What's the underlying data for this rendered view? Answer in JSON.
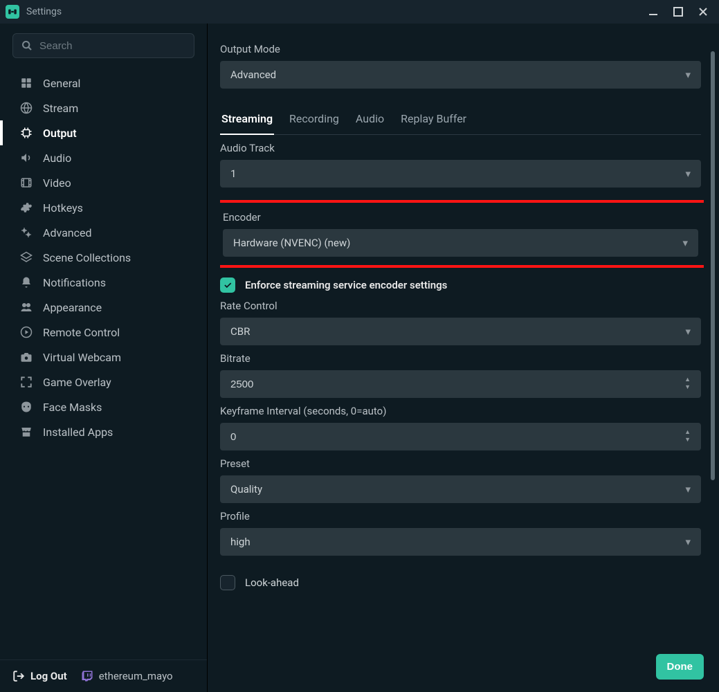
{
  "window": {
    "title": "Settings"
  },
  "search": {
    "placeholder": "Search"
  },
  "sidebar": {
    "items": [
      {
        "label": "General",
        "icon": "grid-icon"
      },
      {
        "label": "Stream",
        "icon": "globe-icon"
      },
      {
        "label": "Output",
        "icon": "chip-icon"
      },
      {
        "label": "Audio",
        "icon": "speaker-icon"
      },
      {
        "label": "Video",
        "icon": "film-icon"
      },
      {
        "label": "Hotkeys",
        "icon": "gear-icon"
      },
      {
        "label": "Advanced",
        "icon": "gears-icon"
      },
      {
        "label": "Scene Collections",
        "icon": "layers-icon"
      },
      {
        "label": "Notifications",
        "icon": "bell-icon"
      },
      {
        "label": "Appearance",
        "icon": "user-icon"
      },
      {
        "label": "Remote Control",
        "icon": "play-icon"
      },
      {
        "label": "Virtual Webcam",
        "icon": "camera-icon"
      },
      {
        "label": "Game Overlay",
        "icon": "expand-icon"
      },
      {
        "label": "Face Masks",
        "icon": "mask-icon"
      },
      {
        "label": "Installed Apps",
        "icon": "store-icon"
      }
    ],
    "activeIndex": 2
  },
  "footer": {
    "logout": "Log Out",
    "username": "ethereum_mayo"
  },
  "output": {
    "modeLabel": "Output Mode",
    "modeValue": "Advanced",
    "tabs": [
      "Streaming",
      "Recording",
      "Audio",
      "Replay Buffer"
    ],
    "activeTab": 0,
    "audioTrackLabel": "Audio Track",
    "audioTrackValue": "1",
    "encoderLabel": "Encoder",
    "encoderValue": "Hardware (NVENC) (new)",
    "enforceLabel": "Enforce streaming service encoder settings",
    "enforceChecked": true,
    "rateControlLabel": "Rate Control",
    "rateControlValue": "CBR",
    "bitrateLabel": "Bitrate",
    "bitrateValue": "2500",
    "keyframeLabel": "Keyframe Interval (seconds, 0=auto)",
    "keyframeValue": "0",
    "presetLabel": "Preset",
    "presetValue": "Quality",
    "profileLabel": "Profile",
    "profileValue": "high",
    "lookaheadLabel": "Look-ahead",
    "lookaheadChecked": false
  },
  "doneLabel": "Done"
}
